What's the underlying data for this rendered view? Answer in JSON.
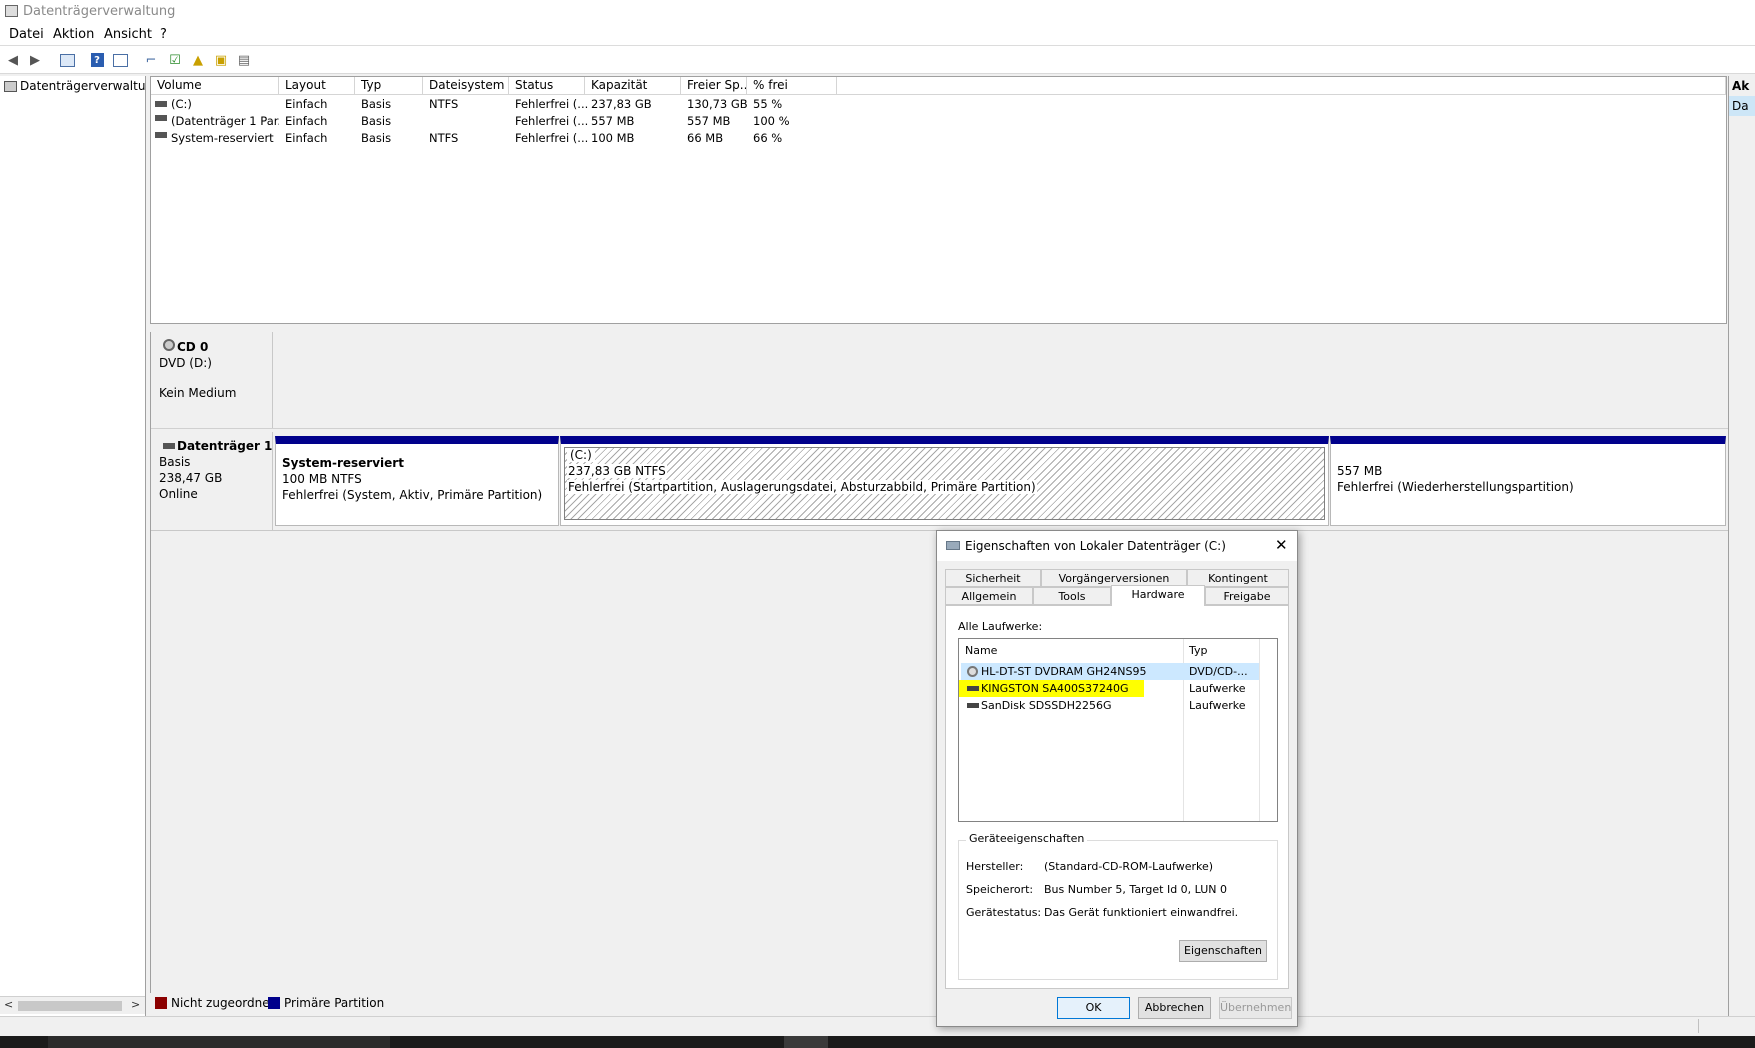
{
  "window": {
    "title": "Datenträgerverwaltung"
  },
  "menu": [
    "Datei",
    "Aktion",
    "Ansicht",
    "?"
  ],
  "tree": {
    "root": "Datenträgerverwaltung"
  },
  "right_pane": {
    "header": "Ak",
    "item": "Da"
  },
  "volume_table": {
    "columns": [
      "Volume",
      "Layout",
      "Typ",
      "Dateisystem",
      "Status",
      "Kapazität",
      "Freier Sp...",
      "% frei"
    ],
    "rows": [
      [
        "(C:)",
        "Einfach",
        "Basis",
        "NTFS",
        "Fehlerfrei (...",
        "237,83 GB",
        "130,73 GB",
        "55 %"
      ],
      [
        "(Datenträger 1 Par...",
        "Einfach",
        "Basis",
        "",
        "Fehlerfrei (...",
        "557 MB",
        "557 MB",
        "100 %"
      ],
      [
        "System-reserviert",
        "Einfach",
        "Basis",
        "NTFS",
        "Fehlerfrei (...",
        "100 MB",
        "66 MB",
        "66 %"
      ]
    ]
  },
  "cd0": {
    "name": "CD 0",
    "drive": "DVD (D:)",
    "media": "Kein Medium"
  },
  "disk1": {
    "name": "Datenträger 1",
    "type": "Basis",
    "size": "238,47 GB",
    "state": "Online",
    "partitions": [
      {
        "title": "System-reserviert",
        "size": "100 MB NTFS",
        "status": "Fehlerfrei (System, Aktiv, Primäre Partition)"
      },
      {
        "title": "(C:)",
        "size": "237,83 GB NTFS",
        "status": "Fehlerfrei (Startpartition, Auslagerungsdatei, Absturzabbild, Primäre Partition)"
      },
      {
        "title": "",
        "size": "557 MB",
        "status": "Fehlerfrei (Wiederherstellungspartition)"
      }
    ]
  },
  "legend": {
    "unallocated": "Nicht zugeordnet",
    "primary": "Primäre Partition",
    "unallocated_color": "#8b0000",
    "primary_color": "#00008b"
  },
  "dialog": {
    "title": "Eigenschaften von Lokaler Datenträger (C:)",
    "tabs_row1": [
      "Sicherheit",
      "Vorgängerversionen",
      "Kontingent"
    ],
    "tabs_row2": [
      "Allgemein",
      "Tools",
      "Hardware",
      "Freigabe"
    ],
    "all_drives_label": "Alle Laufwerke:",
    "list_headers": [
      "Name",
      "Typ"
    ],
    "drives": [
      {
        "name": "HL-DT-ST DVDRAM GH24NS95",
        "type": "DVD/CD-..."
      },
      {
        "name": "KINGSTON SA400S37240G",
        "type": "Laufwerke"
      },
      {
        "name": "SanDisk SDSSDH2256G",
        "type": "Laufwerke"
      }
    ],
    "highlight_color": "#ffff00",
    "device_props_label": "Geräteeigenschaften",
    "manufacturer_label": "Hersteller:",
    "manufacturer": "(Standard-CD-ROM-Laufwerke)",
    "location_label": "Speicherort:",
    "location": "Bus Number 5, Target Id 0, LUN 0",
    "status_label": "Gerätestatus:",
    "status": "Das Gerät funktioniert einwandfrei.",
    "properties_button": "Eigenschaften",
    "ok": "OK",
    "cancel": "Abbrechen",
    "apply": "Übernehmen"
  }
}
